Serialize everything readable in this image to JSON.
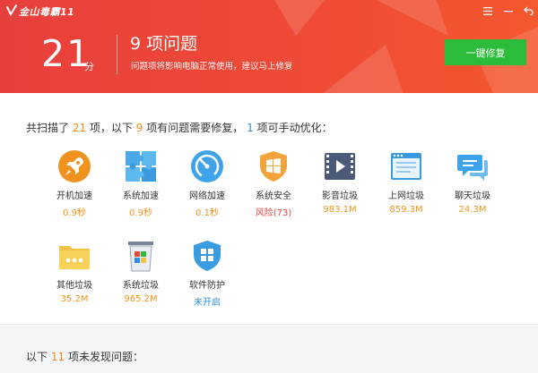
{
  "app": {
    "title": "金山毒霸11"
  },
  "window": {
    "menu_icon": "menu-icon",
    "minimize_icon": "minimize-icon",
    "back_icon": "back-icon"
  },
  "header": {
    "score": "21",
    "score_unit": "分",
    "problem_title": "9 项问题",
    "problem_desc": "问题项将影响电脑正常使用，建议马上修复",
    "fix_button": "一键修复"
  },
  "summary": {
    "prefix": "共扫描了",
    "scanned": "21",
    "mid1": "项，以下",
    "problems": "9",
    "mid2": "项有问题需要修复，",
    "manual": "1",
    "suffix": "项可手动优化："
  },
  "items": [
    {
      "label": "开机加速",
      "value": "0.9秒",
      "icon": "rocket-icon"
    },
    {
      "label": "系统加速",
      "value": "0.9秒",
      "icon": "puzzle-icon"
    },
    {
      "label": "网络加速",
      "value": "0.1秒",
      "icon": "speedometer-icon"
    },
    {
      "label": "系统安全",
      "value": "风险(73)",
      "icon": "windows-shield-icon"
    },
    {
      "label": "影音垃圾",
      "value": "983.1M",
      "icon": "film-icon"
    },
    {
      "label": "上网垃圾",
      "value": "859.3M",
      "icon": "browser-icon"
    },
    {
      "label": "聊天垃圾",
      "value": "24.3M",
      "icon": "chat-icon"
    },
    {
      "label": "其他垃圾",
      "value": "35.2M",
      "icon": "folder-icon"
    },
    {
      "label": "系统垃圾",
      "value": "965.2M",
      "icon": "trash-bin-icon"
    },
    {
      "label": "软件防护",
      "value": "未开启",
      "icon": "shield-icon"
    }
  ],
  "bottom": {
    "prefix": "以下",
    "count": "11",
    "suffix": "项未发现问题："
  },
  "colors": {
    "header_red": "#e83f3c",
    "fix_green": "#2bbd3a",
    "accent_orange": "#f08c1c",
    "accent_blue": "#2a8fe0",
    "risk_red": "#e8453c"
  }
}
